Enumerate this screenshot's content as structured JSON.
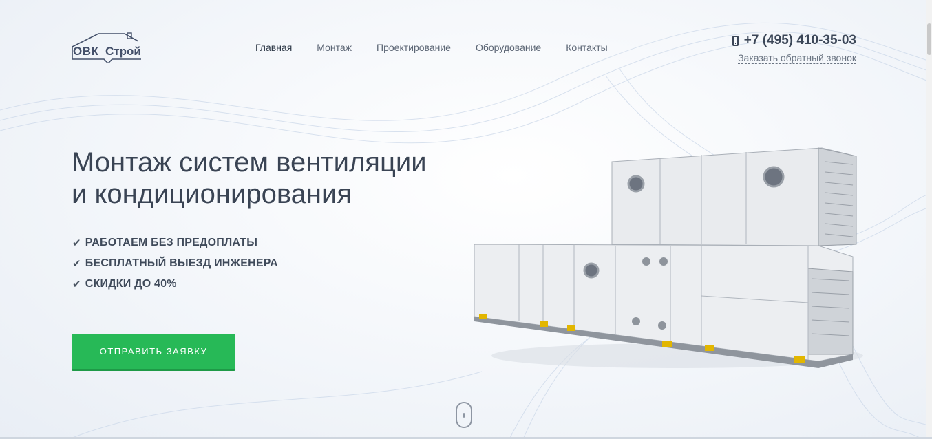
{
  "logo": {
    "part1": "ОВК",
    "part2": "Строй"
  },
  "nav": {
    "items": [
      {
        "label": "Главная",
        "active": true
      },
      {
        "label": "Монтаж",
        "active": false
      },
      {
        "label": "Проектирование",
        "active": false
      },
      {
        "label": "Оборудование",
        "active": false
      },
      {
        "label": "Контакты",
        "active": false
      }
    ]
  },
  "contact": {
    "phone": "+7 (495) 410-35-03",
    "callback_label": "Заказать обратный звонок"
  },
  "hero": {
    "title_line1": "Монтаж систем вентиляции",
    "title_line2": "и кондиционирования",
    "features": [
      "РАБОТАЕМ БЕЗ ПРЕДОПЛАТЫ",
      "БЕСПЛАТНЫЙ ВЫЕЗД ИНЖЕНЕРА",
      "СКИДКИ ДО 40%"
    ],
    "cta_label": "ОТПРАВИТЬ ЗАЯВКУ"
  },
  "colors": {
    "accent": "#27b957",
    "text": "#3a4454"
  }
}
